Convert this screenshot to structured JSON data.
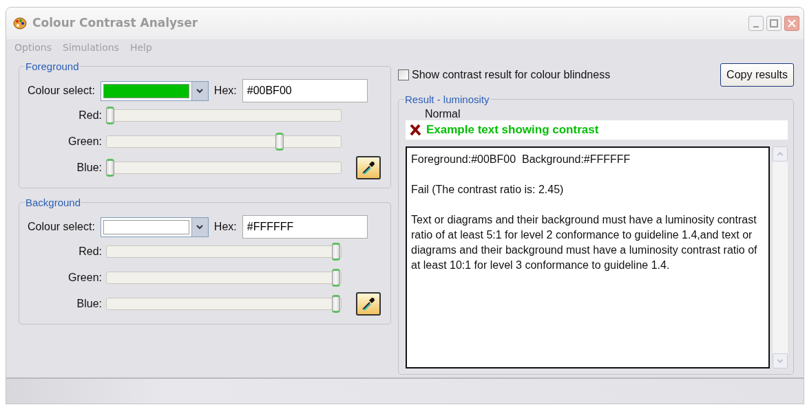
{
  "window": {
    "title": "Colour Contrast Analyser"
  },
  "menu": [
    {
      "label": "Options"
    },
    {
      "label": "Simulations"
    },
    {
      "label": "Help"
    }
  ],
  "colour_groups": [
    {
      "title": "Foreground",
      "select_label": "Colour select:",
      "color": "#00bf00",
      "hex_label": "Hex:",
      "hex": "#00BF00",
      "sliders": [
        {
          "label": "Red:",
          "level": 0
        },
        {
          "label": "Green:",
          "level": 0.75
        },
        {
          "label": "Blue:",
          "level": 0
        }
      ]
    },
    {
      "title": "Background",
      "select_label": "Colour select:",
      "color": "#ffffff",
      "hex_label": "Hex:",
      "hex": "#FFFFFF",
      "sliders": [
        {
          "label": "Red:",
          "level": 1
        },
        {
          "label": "Green:",
          "level": 1
        },
        {
          "label": "Blue:",
          "level": 1
        }
      ]
    }
  ],
  "colour_blindness_checkbox": {
    "label": "Show contrast result for colour blindness",
    "checked": false
  },
  "copy_button": "Copy results",
  "result": {
    "title": "Result - luminosity",
    "caption": "Normal",
    "sample": {
      "text": "Example text showing contrast",
      "pass": false
    },
    "details": [
      "Foreground:#00BF00  Background:#FFFFFF",
      "Fail (The contrast ratio is: 2.45)",
      "Text or diagrams and their background must have a luminosity contrast ratio of at least 5:1 for level 2 conformance to guideline 1.4,and text or diagrams and their background must have a luminosity contrast ratio of at least 10:1 for level 3 conformance to guideline 1.4."
    ]
  }
}
